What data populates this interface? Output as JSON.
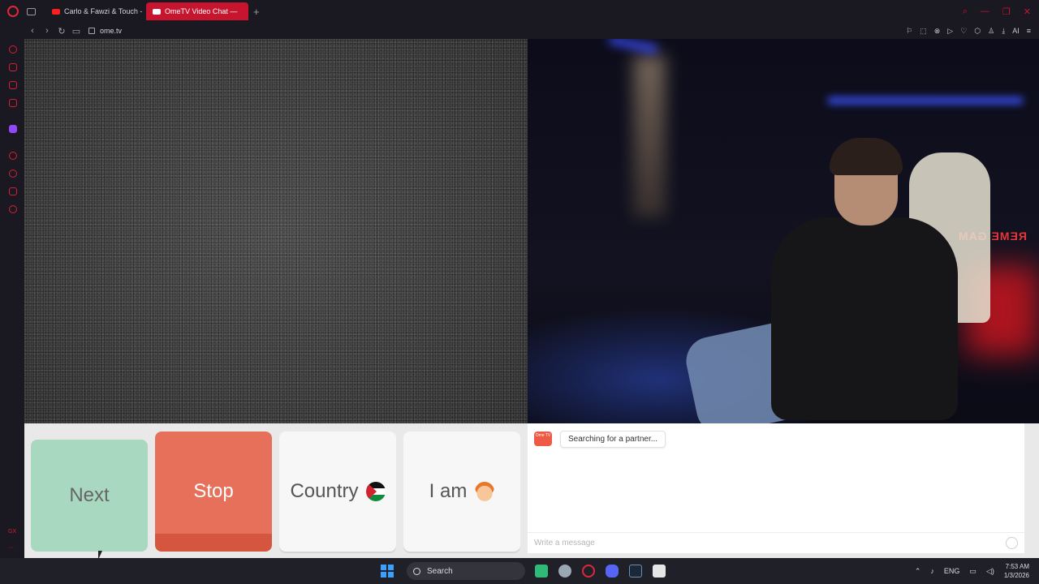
{
  "browser": {
    "tabs": [
      {
        "label": "Carlo & Fawzi & Touch - Yo",
        "active": false
      },
      {
        "label": "OmeTV Video Chat — ",
        "active": true
      }
    ],
    "new_tab": "+",
    "url": "ome.tv",
    "ai_label": "AI",
    "sidebar_gx": "GX",
    "sidebar_more": "···"
  },
  "right_video": {
    "sign_text": "REME GAM"
  },
  "controls": {
    "next_label": "Next",
    "stop_label": "Stop",
    "country_label": "Country",
    "iam_label": "I am"
  },
  "chat": {
    "logo_text": "Ome TV",
    "status_message": "Searching for a partner...",
    "input_placeholder": "Write a message"
  },
  "taskbar": {
    "search_label": "Search",
    "language": "ENG",
    "time": "7:53 AM",
    "date": "1/3/2026"
  },
  "colors": {
    "accent": "#c8152f",
    "next_button": "#a8d8bf",
    "stop_button": "#e7705a"
  }
}
